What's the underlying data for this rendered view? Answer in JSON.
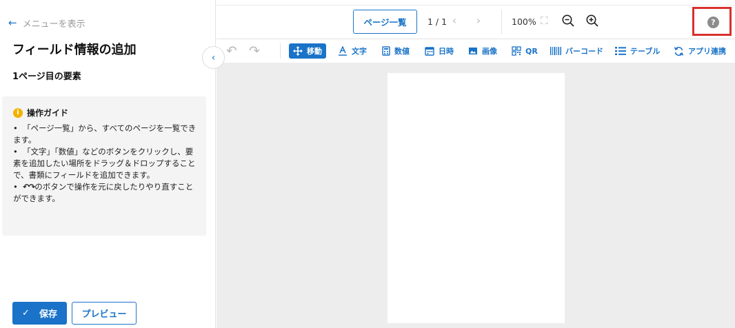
{
  "left_panel": {
    "back_label": "メニューを表示",
    "title": "フィールド情報の追加",
    "subtitle": "1ページ目の要素",
    "guide": {
      "heading": "操作ガイド",
      "items": [
        "「ページ一覧」から、すべてのページを一覧できます。",
        "「文字」「数値」などのボタンをクリックし、要素を追加したい場所をドラッグ＆ドロップすることで、書類にフィールドを追加できます。",
        "のボタンで操作を元に戻したりやり直すことができます。"
      ]
    },
    "save_label": "保存",
    "preview_label": "プレビュー"
  },
  "topbar": {
    "page_list_label": "ページ一覧",
    "page_indicator": "1 / 1",
    "zoom_level": "100%"
  },
  "toolbar": {
    "tools": [
      {
        "label": "移動",
        "icon": "move-icon",
        "active": true
      },
      {
        "label": "文字",
        "icon": "text-icon"
      },
      {
        "label": "数値",
        "icon": "calculator-icon"
      },
      {
        "label": "日時",
        "icon": "calendar-icon"
      },
      {
        "label": "画像",
        "icon": "image-icon"
      },
      {
        "label": "QR",
        "icon": "qr-icon"
      },
      {
        "label": "バーコード",
        "icon": "barcode-icon"
      },
      {
        "label": "テーブル",
        "icon": "list-icon"
      },
      {
        "label": "アプリ連携",
        "icon": "sync-icon"
      }
    ]
  },
  "colors": {
    "accent": "#1a73c8",
    "help_highlight": "#d9302c",
    "info": "#f2b300"
  }
}
